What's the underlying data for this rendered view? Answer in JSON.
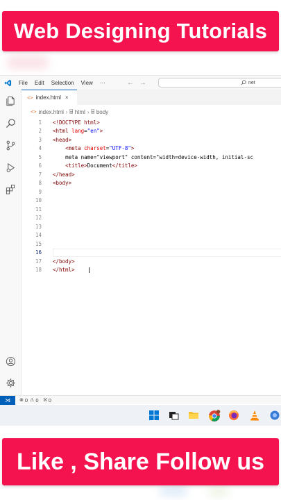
{
  "banners": {
    "top": "Web Designing Tutorials",
    "bottom": "Like , Share Follow us"
  },
  "menu": [
    "File",
    "Edit",
    "Selection",
    "View",
    "···"
  ],
  "command_center": "net",
  "tab": {
    "icon": "<>",
    "label": "index.html",
    "close": "×"
  },
  "breadcrumb": [
    "index.html",
    "html",
    "body"
  ],
  "code_lines": [
    {
      "n": "1",
      "text": "<!DOCTYPE html>"
    },
    {
      "n": "2",
      "text": "<html lang=\"en\">"
    },
    {
      "n": "3",
      "text": "<head>"
    },
    {
      "n": "4",
      "text": "    <meta charset=\"UTF-8\">"
    },
    {
      "n": "5",
      "text": "    <meta name=\"viewport\" content=\"width=device-width, initial-sc"
    },
    {
      "n": "6",
      "text": "    <title>Document</title>"
    },
    {
      "n": "7",
      "text": "</head>"
    },
    {
      "n": "8",
      "text": "<body>"
    },
    {
      "n": "9",
      "text": ""
    },
    {
      "n": "10",
      "text": ""
    },
    {
      "n": "11",
      "text": ""
    },
    {
      "n": "12",
      "text": ""
    },
    {
      "n": "13",
      "text": ""
    },
    {
      "n": "14",
      "text": ""
    },
    {
      "n": "15",
      "text": ""
    },
    {
      "n": "16",
      "text": ""
    },
    {
      "n": "17",
      "text": "</body>"
    },
    {
      "n": "18",
      "text": "</html>"
    }
  ],
  "current_line": "16",
  "status": {
    "errors": "0",
    "warnings": "0",
    "ports": "0"
  },
  "colors": {
    "banner": "#f5134f",
    "accent": "#005fb8"
  }
}
